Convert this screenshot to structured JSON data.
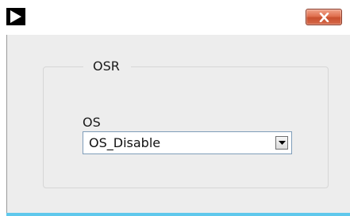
{
  "window": {
    "app_icon": "play-triangle-icon",
    "close_icon": "close-x-icon"
  },
  "groupbox": {
    "title": "OSR"
  },
  "os_field": {
    "label": "OS",
    "selected_value": "OS_Disable",
    "dropdown_icon": "chevron-down-icon"
  },
  "colors": {
    "client_background": "#ededed",
    "close_button": "#d8654a",
    "accent_border": "#5fc8ec"
  }
}
